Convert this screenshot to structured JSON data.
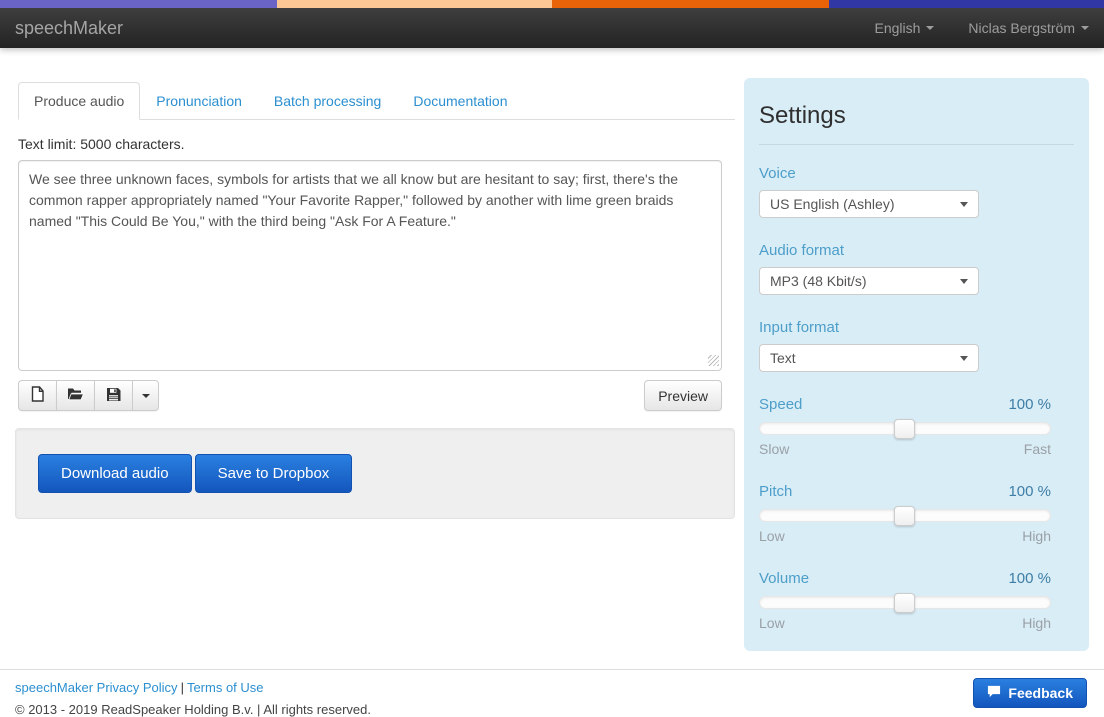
{
  "navbar": {
    "brand": "speechMaker",
    "language_label": "English",
    "user_label": "Niclas Bergström"
  },
  "tabs": [
    {
      "label": "Produce audio",
      "active": true
    },
    {
      "label": "Pronunciation",
      "active": false
    },
    {
      "label": "Batch processing",
      "active": false
    },
    {
      "label": "Documentation",
      "active": false
    }
  ],
  "editor": {
    "limit_note": "Text limit: 5000 characters.",
    "text": "We see three unknown faces, symbols for artists that we all know but are hesitant to say; first, there's the common rapper appropriately named \"Your Favorite Rapper,\" followed by another with lime green braids named \"This Could Be You,\" with the third being \"Ask For A Feature.\"",
    "preview_label": "Preview"
  },
  "actions": {
    "download_label": "Download audio",
    "dropbox_label": "Save to Dropbox"
  },
  "settings": {
    "title": "Settings",
    "voice": {
      "label": "Voice",
      "value": "US English (Ashley)"
    },
    "audio_format": {
      "label": "Audio format",
      "value": "MP3 (48 Kbit/s)"
    },
    "input_format": {
      "label": "Input format",
      "value": "Text"
    },
    "sliders": [
      {
        "label": "Speed",
        "value": "100 %",
        "min": "Slow",
        "max": "Fast",
        "percent": 50
      },
      {
        "label": "Pitch",
        "value": "100 %",
        "min": "Low",
        "max": "High",
        "percent": 50
      },
      {
        "label": "Volume",
        "value": "100 %",
        "min": "Low",
        "max": "High",
        "percent": 50
      }
    ]
  },
  "footer": {
    "privacy_link": "speechMaker Privacy Policy",
    "separator": "|",
    "terms_link": "Terms of Use",
    "copyright": "© 2013 - 2019 ReadSpeaker Holding B.v. | All rights reserved.",
    "feedback_label": "Feedback"
  },
  "icons": {
    "toolbar": [
      "new-document",
      "open-folder",
      "save",
      "caret-down"
    ],
    "navbar_menus": "caret-down",
    "select_arrow": "caret-down",
    "feedback": "chat-bubble",
    "textarea_corner": "resize-grip"
  },
  "colors": {
    "stripe_purple": "#6a64c6",
    "stripe_peach": "#fcc795",
    "stripe_orange": "#e86207",
    "stripe_indigo": "#3138a5",
    "link_blue": "#2b8fd0",
    "settings_label_blue": "#4d9ec9",
    "settings_value_blue": "#3d7ea6",
    "settings_panel_bg": "#d9edf7",
    "primary_button_top": "#2a80e0",
    "primary_button_bottom": "#1356bd",
    "navbar_bg": "#232323"
  }
}
